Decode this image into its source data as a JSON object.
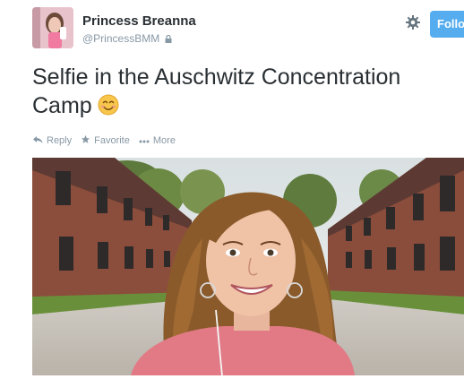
{
  "user": {
    "name": "Princess Breanna",
    "handle": "@PrincessBMM"
  },
  "follow_label": "Follow",
  "tweet": {
    "text": "Selfie in the Auschwitz Concentration Camp"
  },
  "actions": [
    {
      "label": "Reply",
      "icon": "reply-icon"
    },
    {
      "label": "Favorite",
      "icon": "star-icon"
    },
    {
      "label": "More",
      "icon": "more-icon"
    }
  ],
  "colors": {
    "accent": "#55acee",
    "name": "#292f33",
    "muted": "#8899a6"
  }
}
